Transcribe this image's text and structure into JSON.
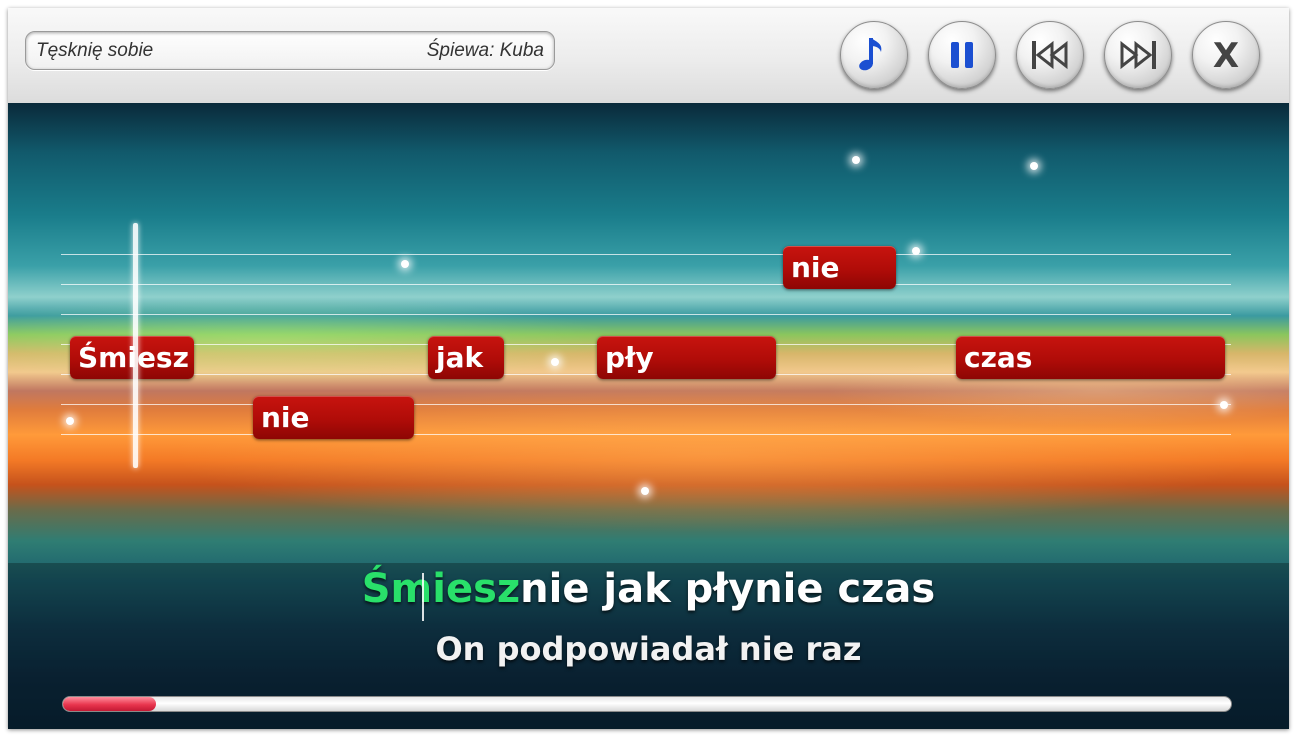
{
  "header": {
    "song_title": "Tęsknię sobie",
    "singer": "Śpiewa: Kuba"
  },
  "controls": [
    {
      "name": "music-note-icon",
      "label": "music"
    },
    {
      "name": "pause-icon",
      "label": "pause"
    },
    {
      "name": "skip-back-icon",
      "label": "previous"
    },
    {
      "name": "skip-forward-icon",
      "label": "next"
    },
    {
      "name": "close-icon",
      "label": "X"
    }
  ],
  "notes": [
    {
      "text": "Śmiesz",
      "pitch_row": 3
    },
    {
      "text": "nie",
      "pitch_row": 5
    },
    {
      "text": "jak",
      "pitch_row": 3
    },
    {
      "text": "pły",
      "pitch_row": 3
    },
    {
      "text": "nie",
      "pitch_row": 0
    },
    {
      "text": "czas",
      "pitch_row": 3
    }
  ],
  "lyrics": {
    "current_sung": "Śmiesz",
    "current_rest": "nie jak płynie czas",
    "next_line": "On podpowiadał nie raz"
  },
  "progress": {
    "value": 0.08
  },
  "colors": {
    "note": "#b00c08",
    "sung_text": "#29e06a",
    "progress": "#e8354e"
  }
}
